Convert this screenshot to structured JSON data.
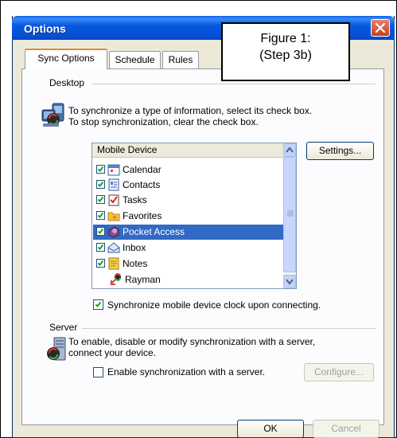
{
  "window": {
    "title": "Options"
  },
  "figure": {
    "line1": "Figure 1:",
    "line2": "(Step 3b)"
  },
  "tabs": [
    {
      "label": "Sync Options",
      "active": true
    },
    {
      "label": "Schedule",
      "active": false
    },
    {
      "label": "Rules",
      "active": false
    }
  ],
  "desktop": {
    "group_label": "Desktop",
    "instructions_line1": "To synchronize a type of information, select its check box.",
    "instructions_line2": "To stop synchronization, clear the check box."
  },
  "list": {
    "header": "Mobile Device",
    "items": [
      {
        "label": "Calendar",
        "checked": true,
        "icon": "calendar-icon"
      },
      {
        "label": "Contacts",
        "checked": true,
        "icon": "contacts-icon"
      },
      {
        "label": "Tasks",
        "checked": true,
        "icon": "tasks-icon"
      },
      {
        "label": "Favorites",
        "checked": true,
        "icon": "favorites-folder-icon"
      },
      {
        "label": "Pocket Access",
        "checked": true,
        "icon": "pocket-access-icon",
        "selected": true
      },
      {
        "label": "Inbox",
        "checked": true,
        "icon": "inbox-icon"
      },
      {
        "label": "Notes",
        "checked": true,
        "icon": "notes-icon"
      },
      {
        "label": "Rayman",
        "checked": false,
        "icon": "rayman-icon"
      }
    ]
  },
  "buttons": {
    "settings": "Settings...",
    "configure": "Configure...",
    "ok": "OK",
    "cancel": "Cancel"
  },
  "sync_clock": {
    "label": "Synchronize mobile device clock upon connecting.",
    "checked": true
  },
  "server": {
    "group_label": "Server",
    "instructions_line1": "To enable, disable or modify synchronization with a server,",
    "instructions_line2": "connect your device.",
    "enable_label": "Enable synchronization with a server.",
    "enable_checked": false
  },
  "colors": {
    "title_blue": "#0658e0",
    "selection": "#316ac5",
    "dialog_bg": "#ece9d8",
    "close_red": "#c7401e"
  }
}
